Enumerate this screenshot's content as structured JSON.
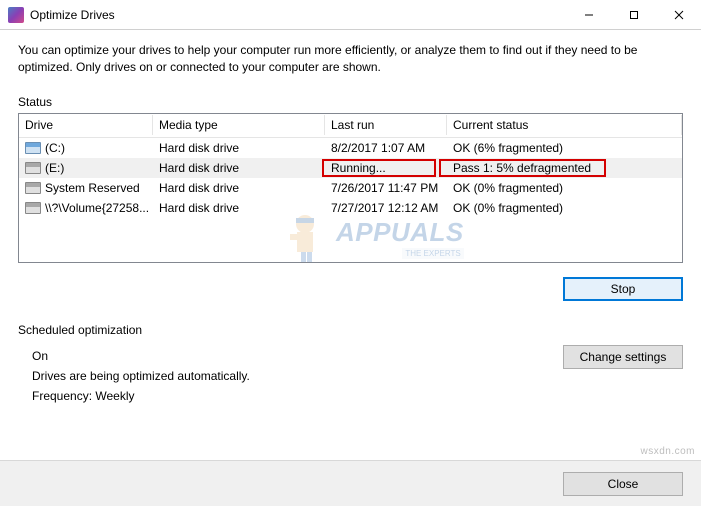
{
  "window": {
    "title": "Optimize Drives"
  },
  "description": "You can optimize your drives to help your computer run more efficiently, or analyze them to find out if they need to be optimized. Only drives on or connected to your computer are shown.",
  "status_label": "Status",
  "columns": {
    "drive": "Drive",
    "media": "Media type",
    "lastrun": "Last run",
    "status": "Current status"
  },
  "rows": [
    {
      "icon": "os",
      "drive": "(C:)",
      "media": "Hard disk drive",
      "lastrun": "8/2/2017 1:07 AM",
      "status": "OK (6% fragmented)",
      "selected": false
    },
    {
      "icon": "hdd",
      "drive": "(E:)",
      "media": "Hard disk drive",
      "lastrun": "Running...",
      "status": "Pass 1: 5% defragmented",
      "selected": true
    },
    {
      "icon": "hdd",
      "drive": "System Reserved",
      "media": "Hard disk drive",
      "lastrun": "7/26/2017 11:47 PM",
      "status": "OK (0% fragmented)",
      "selected": false
    },
    {
      "icon": "hdd",
      "drive": "\\\\?\\Volume{27258...",
      "media": "Hard disk drive",
      "lastrun": "7/27/2017 12:12 AM",
      "status": "OK (0% fragmented)",
      "selected": false
    }
  ],
  "buttons": {
    "stop": "Stop",
    "change_settings": "Change settings",
    "close": "Close"
  },
  "sched": {
    "label": "Scheduled optimization",
    "state": "On",
    "desc": "Drives are being optimized automatically.",
    "freq": "Frequency: Weekly"
  },
  "watermark": {
    "brand": "APPUALS",
    "tag": "THE EXPERTS",
    "url": "wsxdn.com"
  }
}
